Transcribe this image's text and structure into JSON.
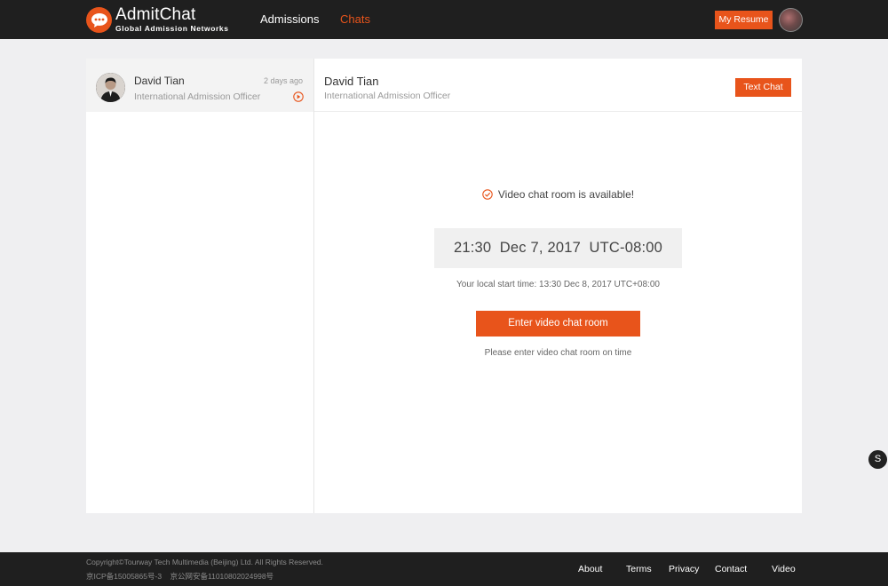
{
  "brand": {
    "name": "AdmitChat",
    "tagline": "Global Admission Networks",
    "accent_color": "#e8541b",
    "logo_icon": "chat-bubble-icon"
  },
  "nav": {
    "items": [
      {
        "label": "Admissions",
        "active": false
      },
      {
        "label": "Chats",
        "active": true
      }
    ],
    "resume_label": "My Resume",
    "avatar_icon": "user-avatar"
  },
  "sidebar": {
    "conversations": [
      {
        "name": "David Tian",
        "role": "International Admission Officer",
        "time": "2 days ago",
        "status_icon": "play-circle-icon"
      }
    ]
  },
  "chat": {
    "name": "David Tian",
    "role": "International Admission Officer",
    "text_chat_label": "Text Chat",
    "availability": "Video chat room is available!",
    "availability_icon": "check-circle-icon",
    "scheduled_time": "21:30  Dec 7, 2017  UTC-08:00",
    "local_time": "Your local start time: 13:30 Dec 8, 2017 UTC+08:00",
    "enter_label": "Enter video chat room",
    "note": "Please enter video chat room on time"
  },
  "floating": {
    "label": "S"
  },
  "footer": {
    "copyright": "Copyright©Tourway Tech Multimedia (Beijing) Ltd. All Rights Reserved.",
    "icp": "京ICP备15005865号-3    京公网安备11010802024998号",
    "links": [
      "About",
      "Terms",
      "Privacy",
      "Contact",
      "Video"
    ]
  }
}
